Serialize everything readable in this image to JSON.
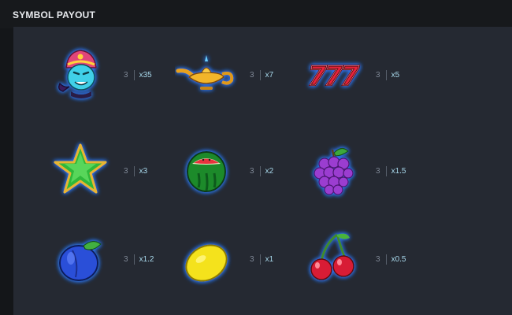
{
  "header": {
    "title": "SYMBOL PAYOUT"
  },
  "symbols": [
    {
      "icon": "genie-icon",
      "count": "3",
      "multiplier": "x35"
    },
    {
      "icon": "magic-lamp-icon",
      "count": "3",
      "multiplier": "x7"
    },
    {
      "icon": "triple-seven-icon",
      "count": "3",
      "multiplier": "x5"
    },
    {
      "icon": "star-icon",
      "count": "3",
      "multiplier": "x3"
    },
    {
      "icon": "watermelon-icon",
      "count": "3",
      "multiplier": "x2"
    },
    {
      "icon": "grapes-icon",
      "count": "3",
      "multiplier": "x1.5"
    },
    {
      "icon": "plum-icon",
      "count": "3",
      "multiplier": "x1.2"
    },
    {
      "icon": "lemon-icon",
      "count": "3",
      "multiplier": "x1"
    },
    {
      "icon": "cherries-icon",
      "count": "3",
      "multiplier": "x0.5"
    }
  ],
  "colors": {
    "background": "#141619",
    "panel": "#252932",
    "glow": "#2f7bff",
    "multiplier_text": "#a7d7ea"
  }
}
